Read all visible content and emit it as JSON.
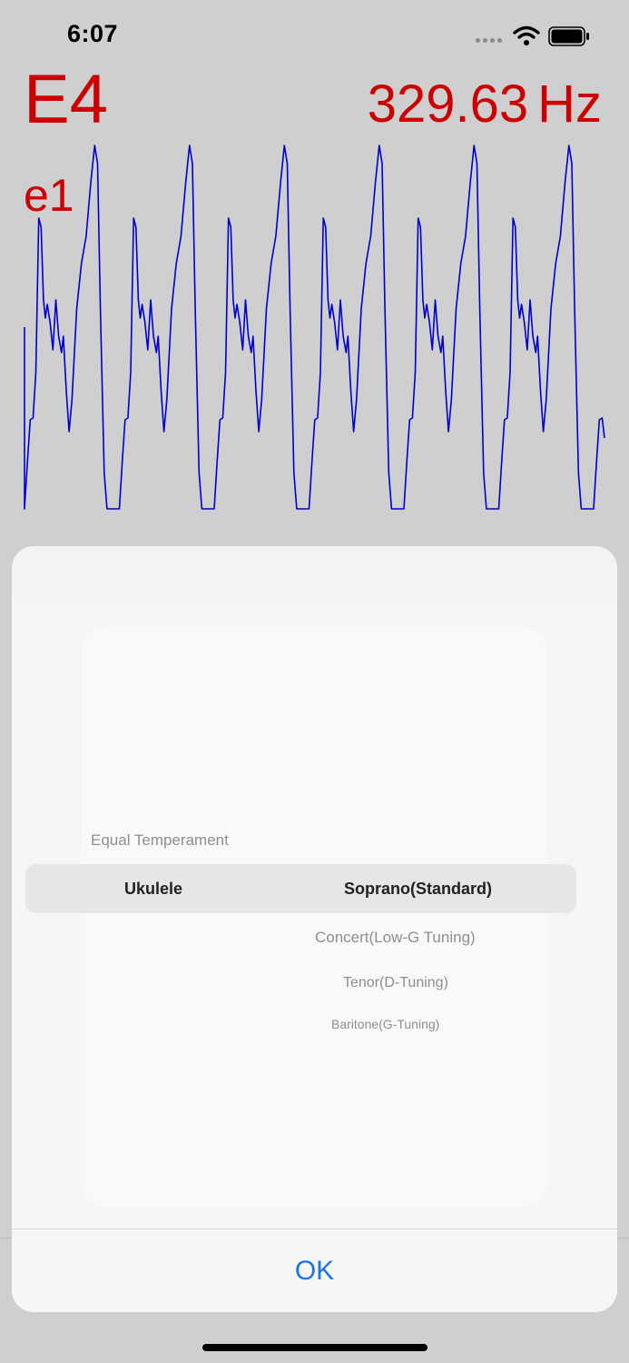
{
  "status_bar": {
    "time": "6:07",
    "icons": [
      "signal-dots-icon",
      "wifi-icon",
      "battery-icon"
    ]
  },
  "tuner": {
    "note": "E4",
    "frequency_value": "329.63",
    "frequency_unit": "Hz",
    "string_name": "e1",
    "note_color": "#cc0000",
    "waveform_color": "#0000cc"
  },
  "picker": {
    "column1": {
      "above": "Equal Temperament",
      "selected": "Ukulele"
    },
    "column2": {
      "selected": "Soprano(Standard)",
      "below": [
        "Concert(Low-G Tuning)",
        "Tenor(D-Tuning)",
        "Baritone(G-Tuning)"
      ]
    }
  },
  "dialog": {
    "ok_label": "OK",
    "accent_color": "#1a73e8"
  }
}
